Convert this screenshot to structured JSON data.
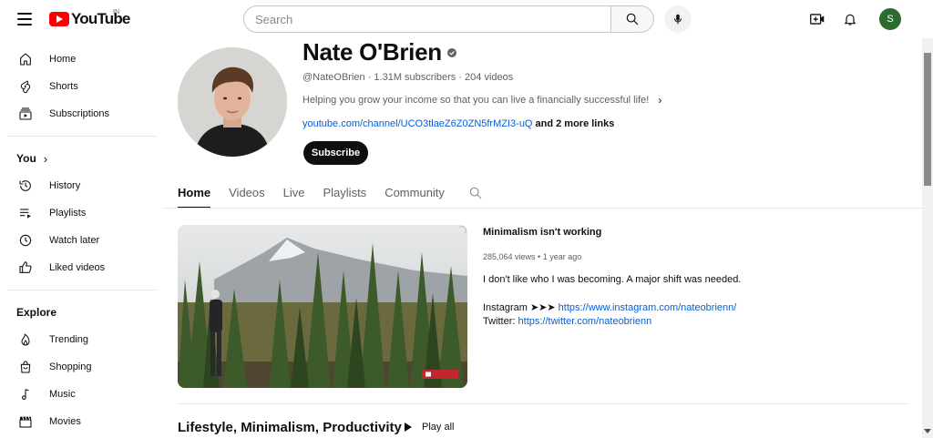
{
  "app": {
    "logo_text": "YouTube",
    "region": "IN"
  },
  "search": {
    "placeholder": "Search"
  },
  "user": {
    "avatar_initial": "S",
    "avatar_color": "#2e6b2f"
  },
  "sidebar": {
    "main": [
      {
        "label": "Home",
        "icon": "home-icon"
      },
      {
        "label": "Shorts",
        "icon": "shorts-icon"
      },
      {
        "label": "Subscriptions",
        "icon": "subscriptions-icon"
      }
    ],
    "you_heading": "You",
    "you_items": [
      {
        "label": "History",
        "icon": "history-icon"
      },
      {
        "label": "Playlists",
        "icon": "playlists-icon"
      },
      {
        "label": "Watch later",
        "icon": "watch-later-icon"
      },
      {
        "label": "Liked videos",
        "icon": "thumbs-up-icon"
      }
    ],
    "explore_heading": "Explore",
    "explore_items": [
      {
        "label": "Trending",
        "icon": "trending-icon"
      },
      {
        "label": "Shopping",
        "icon": "shopping-bag-icon"
      },
      {
        "label": "Music",
        "icon": "music-note-icon"
      },
      {
        "label": "Movies",
        "icon": "clapperboard-icon"
      }
    ]
  },
  "channel": {
    "name": "Nate O'Brien",
    "handle_line": "@NateOBrien · 1.31M subscribers · 204 videos",
    "description": "Helping you grow your income so that you can live a financially successful life!",
    "link": "youtube.com/channel/UCO3tlaeZ6Z0ZN5frMZI3-uQ",
    "more_links": "and 2 more links",
    "subscribe_label": "Subscribe"
  },
  "tabs": [
    {
      "label": "Home",
      "active": true
    },
    {
      "label": "Videos",
      "active": false
    },
    {
      "label": "Live",
      "active": false
    },
    {
      "label": "Playlists",
      "active": false
    },
    {
      "label": "Community",
      "active": false
    }
  ],
  "featured": {
    "title": "Minimalism isn't working",
    "stats": "285,064 views • 1 year ago",
    "line1": "I don't like who I was becoming. A major shift was needed.",
    "instagram_label": "Instagram ➤➤➤ ",
    "instagram_url": "https://www.instagram.com/nateobrienn/",
    "twitter_label": "Twitter: ",
    "twitter_url": "https://twitter.com/nateobrienn"
  },
  "shelf": {
    "title": "Lifestyle, Minimalism, Productivity",
    "play_all": "Play all"
  }
}
